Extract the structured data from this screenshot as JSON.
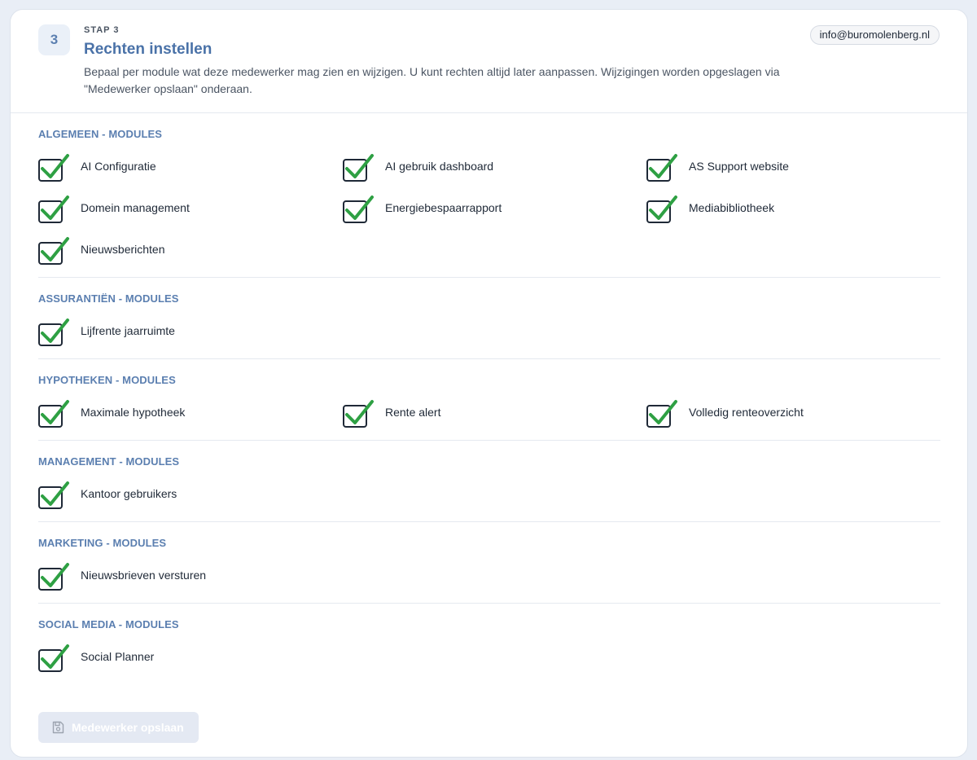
{
  "header": {
    "step_number": "3",
    "step_label": "STAP 3",
    "title": "Rechten instellen",
    "description": "Bepaal per module wat deze medewerker mag zien en wijzigen. U kunt rechten altijd later aanpassen. Wijzigingen worden opgeslagen via \"Medewerker opslaan\" onderaan.",
    "email": "info@buromolenberg.nl"
  },
  "sections": [
    {
      "title": "ALGEMEEN - MODULES",
      "items": [
        {
          "label": "AI Configuratie",
          "checked": true
        },
        {
          "label": "AI gebruik dashboard",
          "checked": true
        },
        {
          "label": "AS Support website",
          "checked": true
        },
        {
          "label": "Domein management",
          "checked": true
        },
        {
          "label": "Energiebespaarrapport",
          "checked": true
        },
        {
          "label": "Mediabibliotheek",
          "checked": true
        },
        {
          "label": "Nieuwsberichten",
          "checked": true
        }
      ]
    },
    {
      "title": "ASSURANTIËN - MODULES",
      "items": [
        {
          "label": "Lijfrente jaarruimte",
          "checked": true
        }
      ]
    },
    {
      "title": "HYPOTHEKEN - MODULES",
      "items": [
        {
          "label": "Maximale hypotheek",
          "checked": true
        },
        {
          "label": "Rente alert",
          "checked": true
        },
        {
          "label": "Volledig renteoverzicht",
          "checked": true
        }
      ]
    },
    {
      "title": "MANAGEMENT - MODULES",
      "items": [
        {
          "label": "Kantoor gebruikers",
          "checked": true
        }
      ]
    },
    {
      "title": "MARKETING - MODULES",
      "items": [
        {
          "label": "Nieuwsbrieven versturen",
          "checked": true
        }
      ]
    },
    {
      "title": "SOCIAL MEDIA - MODULES",
      "items": [
        {
          "label": "Social Planner",
          "checked": true
        }
      ]
    }
  ],
  "footer": {
    "save_label": "Medewerker opslaan",
    "save_icon": "save-icon"
  },
  "colors": {
    "accent": "#4a72a8",
    "check": "#2ea043",
    "background": "#e9eef6"
  }
}
